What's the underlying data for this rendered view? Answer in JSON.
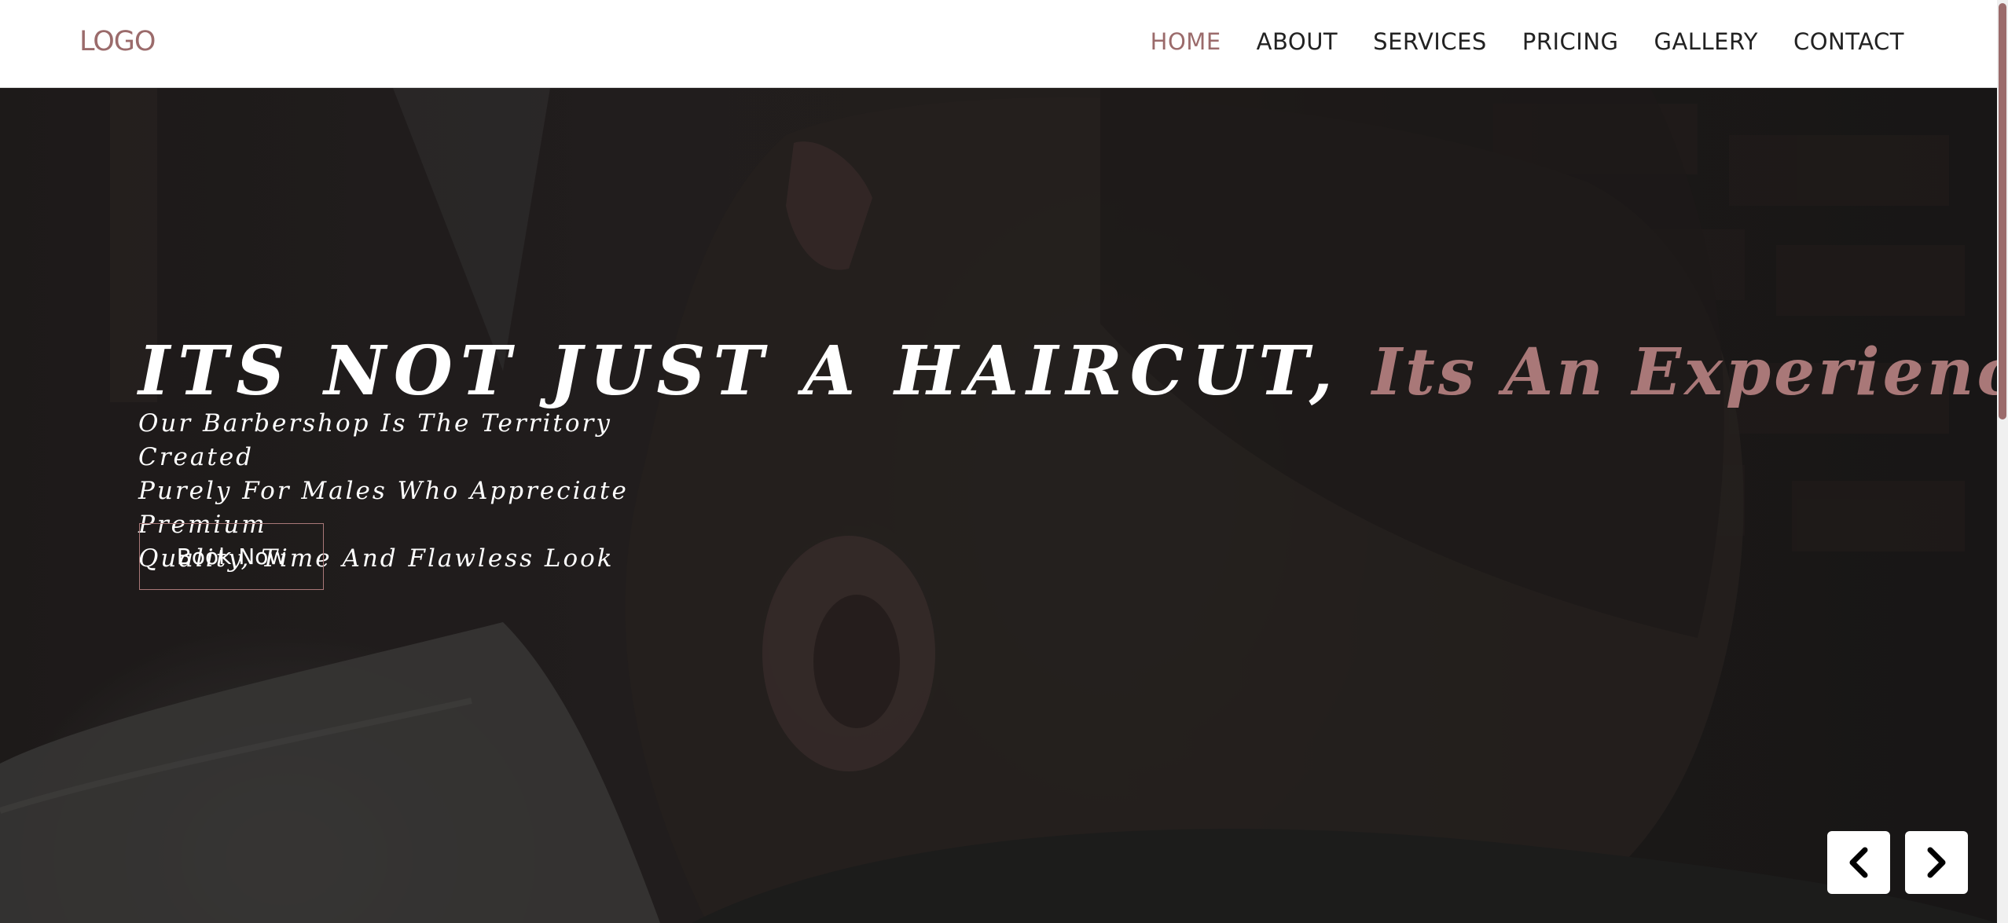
{
  "header": {
    "logo": "LOGO",
    "nav": [
      {
        "label": "HOME",
        "active": true
      },
      {
        "label": "ABOUT",
        "active": false
      },
      {
        "label": "SERVICES",
        "active": false
      },
      {
        "label": "PRICING",
        "active": false
      },
      {
        "label": "GALLERY",
        "active": false
      },
      {
        "label": "CONTACT",
        "active": false
      }
    ]
  },
  "hero": {
    "headline_main": "ITS NOT JUST A HAIRCUT,",
    "headline_accent": "Its An Experience",
    "subtext_lines": [
      "Our Barbershop Is The Territory Created",
      "Purely For Males Who Appreciate Premium",
      "Quality, Time And Flawless Look"
    ],
    "cta_label": "Book Now",
    "prev_icon": "chevron-left-icon",
    "next_icon": "chevron-right-icon"
  },
  "colors": {
    "accent": "#9b6b6b",
    "header_bg": "#ffffff",
    "hero_overlay": "#1b1a1a"
  }
}
